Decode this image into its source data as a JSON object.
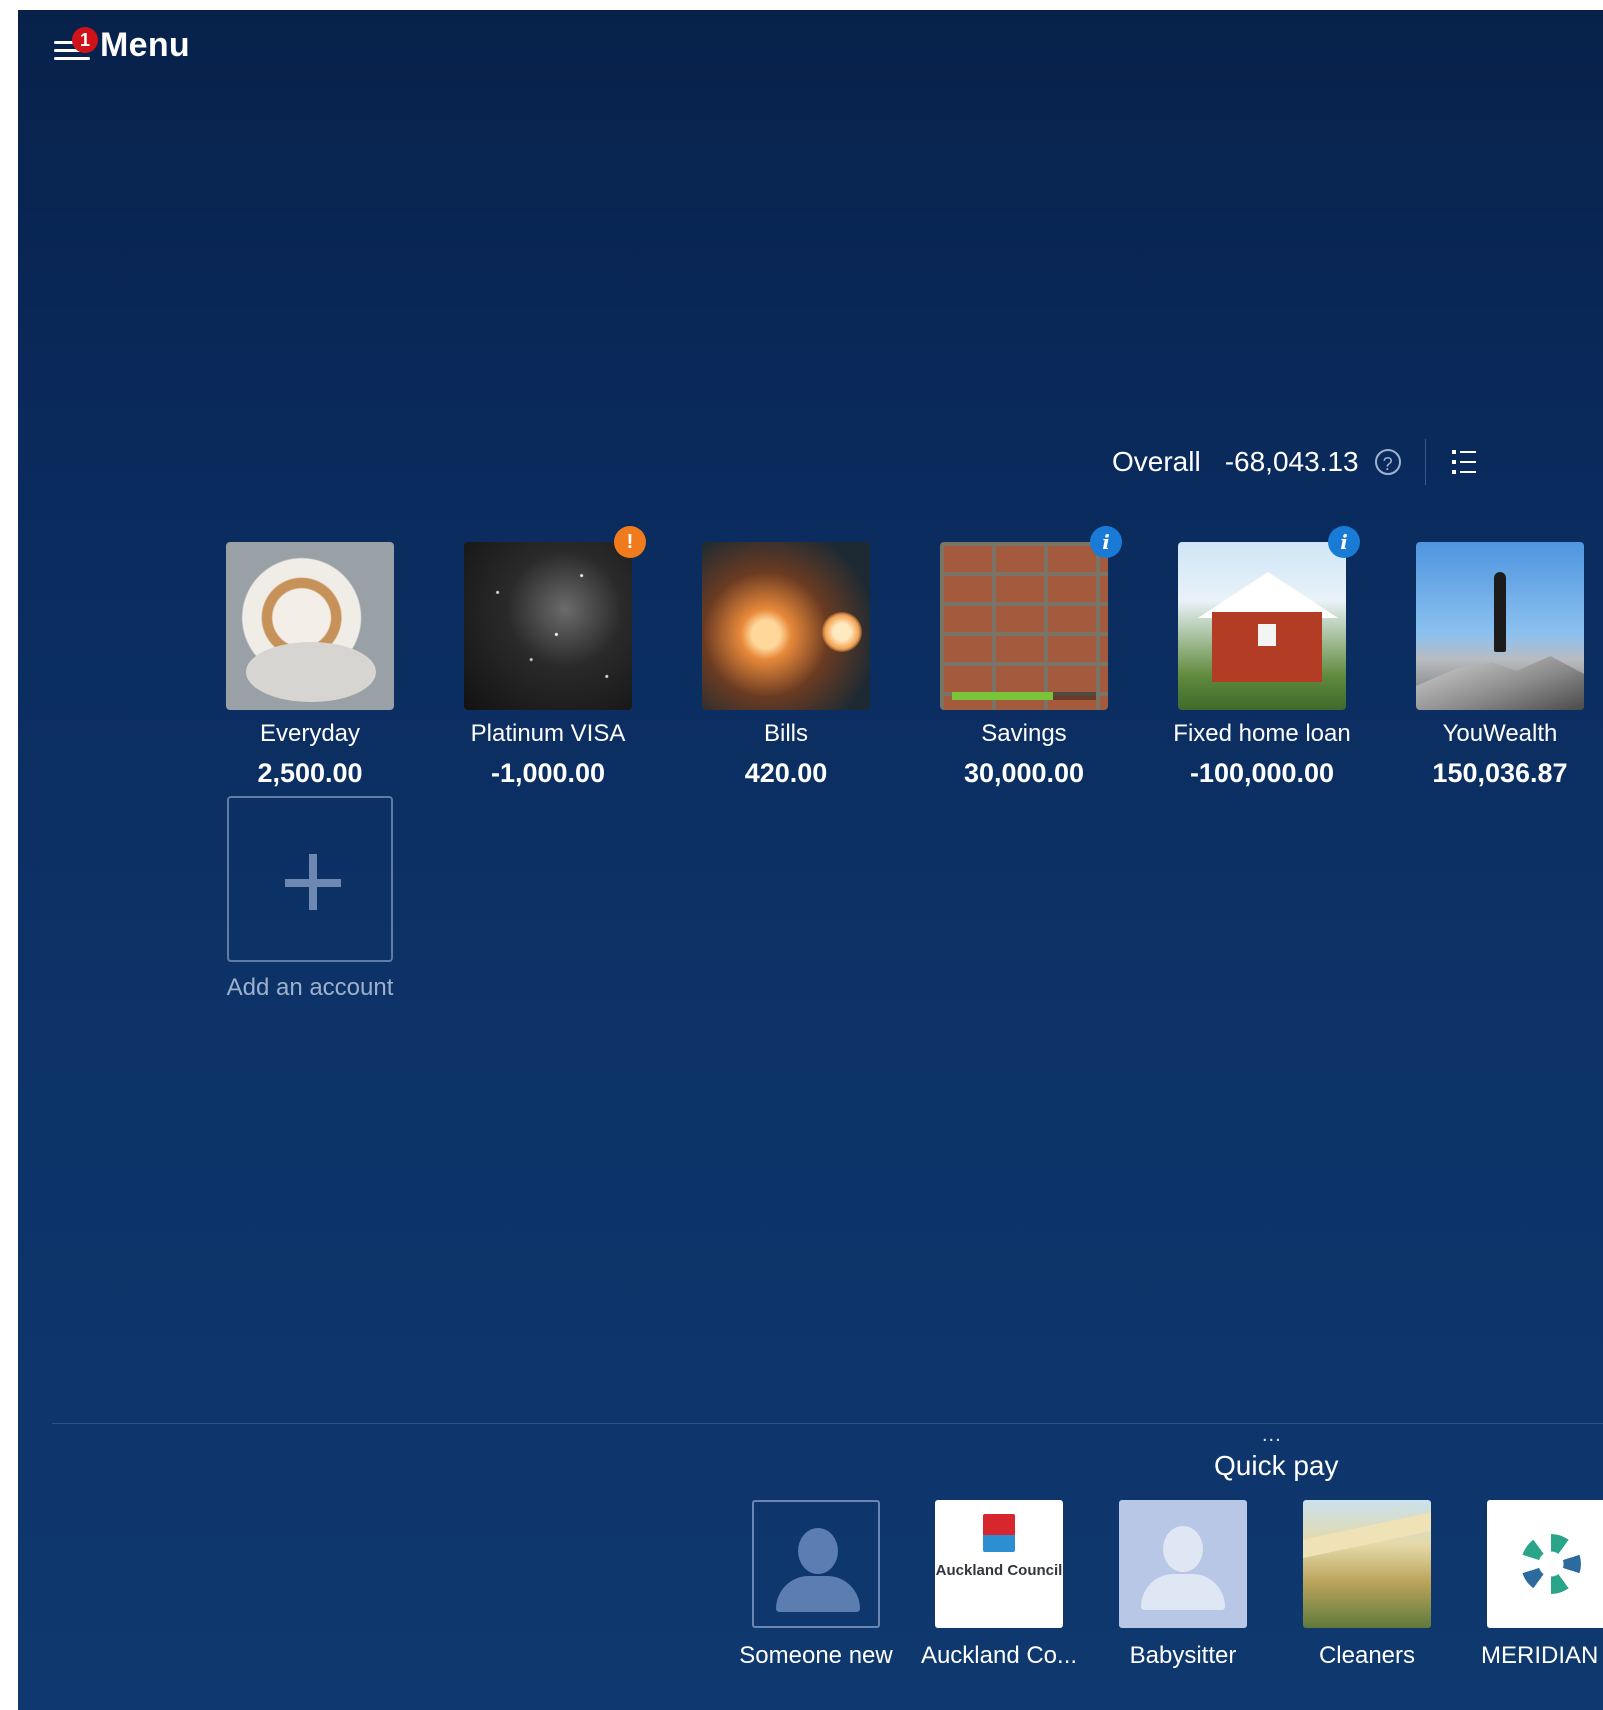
{
  "header": {
    "menu_label": "Menu",
    "notification_count": "1"
  },
  "overall": {
    "label": "Overall",
    "amount": "-68,043.13",
    "help_symbol": "?"
  },
  "accounts": [
    {
      "name": "Everyday",
      "balance": "2,500.00",
      "image": "coffee-cup"
    },
    {
      "name": "Platinum VISA",
      "balance": "-1,000.00",
      "image": "starry-sky",
      "badge": "!"
    },
    {
      "name": "Bills",
      "balance": "420.00",
      "image": "light-bulbs"
    },
    {
      "name": "Savings",
      "balance": "30,000.00",
      "image": "brick-wall",
      "badge": "i",
      "goal_progress": 0.7
    },
    {
      "name": "Fixed home loan",
      "balance": "-100,000.00",
      "image": "red-house",
      "badge": "i"
    },
    {
      "name": "YouWealth",
      "balance": "150,036.87",
      "image": "hiker-on-rock"
    }
  ],
  "add_account": {
    "label": "Add an account",
    "icon": "plus-icon"
  },
  "quick_pay": {
    "handle": "...",
    "title": "Quick pay",
    "payees": [
      {
        "name": "Someone new",
        "image": "person-silhouette"
      },
      {
        "name": "Auckland Co...",
        "image": "auckland-council-logo",
        "logo_text": "Auckland Council"
      },
      {
        "name": "Babysitter",
        "image": "person-silhouette"
      },
      {
        "name": "Cleaners",
        "image": "house-eave"
      },
      {
        "name": "MERIDIAN E",
        "image": "meridian-logo"
      }
    ]
  },
  "colors": {
    "background_top": "#07214a",
    "background_bottom": "#0e386f",
    "notification_badge": "#d0121b",
    "warning_badge": "#f07b1d",
    "info_badge": "#1a7bd6",
    "savings_progress": "#7ac43a"
  }
}
